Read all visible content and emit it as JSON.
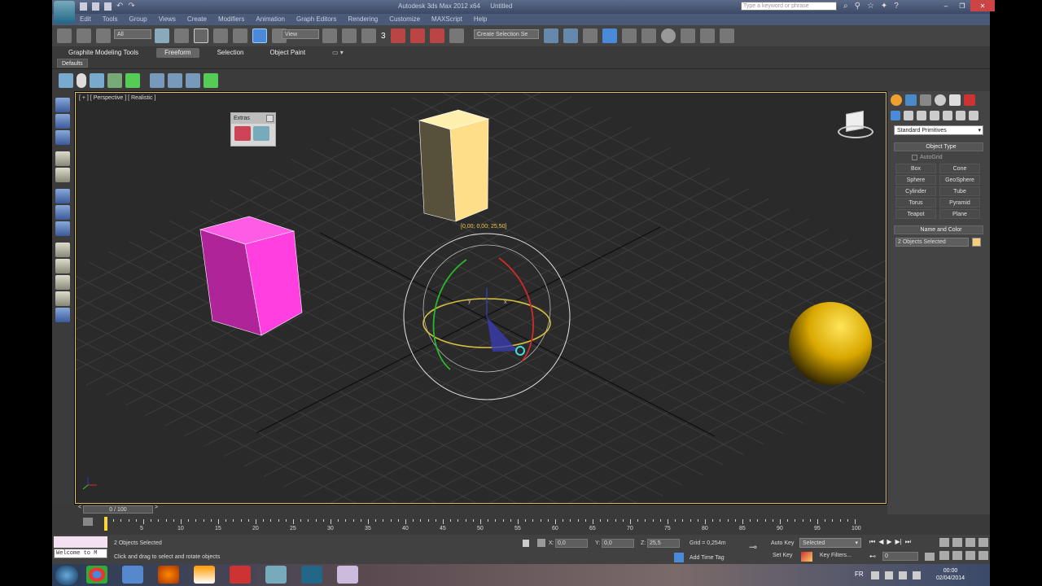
{
  "window": {
    "title": "Autodesk 3ds Max 2012 x64",
    "doc_title": "Untitled",
    "search_placeholder": "Type a keyword or phrase"
  },
  "menu": [
    "Edit",
    "Tools",
    "Group",
    "Views",
    "Create",
    "Modifiers",
    "Animation",
    "Graph Editors",
    "Rendering",
    "Customize",
    "MAXScript",
    "Help"
  ],
  "toolbar": {
    "selection_filter": "All",
    "ref_coord": "View",
    "named_selection": "Create Selection Se",
    "snap_label": "3"
  },
  "ribbon": {
    "tabs": [
      "Graphite Modeling Tools",
      "Freeform",
      "Selection",
      "Object Paint"
    ],
    "active_tab": "Freeform",
    "defaults_label": "Defaults"
  },
  "viewport": {
    "label": "[ + ] [ Perspective ] [ Realistic ]",
    "coord_readout": "[0,00; 0,00; 25,50]",
    "extras_title": "Extras",
    "axis_y": "y",
    "axis_x": "x"
  },
  "command_panel": {
    "category": "Standard Primitives",
    "object_type_title": "Object Type",
    "autogrid": "AutoGrid",
    "buttons": [
      "Box",
      "Cone",
      "Sphere",
      "GeoSphere",
      "Cylinder",
      "Tube",
      "Torus",
      "Pyramid",
      "Teapot",
      "Plane"
    ],
    "name_color_title": "Name and Color",
    "name_value": "2 Objects Selected",
    "swatch_color": "#f5cf7a"
  },
  "timeline": {
    "frame_display": "0 / 100",
    "ticks": [
      "5",
      "10",
      "15",
      "20",
      "25",
      "30",
      "35",
      "40",
      "45",
      "50",
      "55",
      "60",
      "65",
      "70",
      "75",
      "80",
      "85",
      "90",
      "95",
      "100"
    ]
  },
  "status": {
    "listener": "Welcome to M",
    "selection": "2 Objects Selected",
    "prompt": "Click and drag to select and rotate objects",
    "x_label": "X:",
    "x_value": "0,0",
    "y_label": "Y:",
    "y_value": "0,0",
    "z_label": "Z:",
    "z_value": "25,5",
    "grid": "Grid = 0,254m",
    "add_time_tag": "Add Time Tag",
    "auto_key": "Auto Key",
    "set_key": "Set Key",
    "key_mode": "Selected",
    "key_filters": "Key Filters...",
    "frame_value": "0"
  },
  "taskbar": {
    "lang": "FR",
    "time": "00:00",
    "date": "02/04/2014"
  }
}
